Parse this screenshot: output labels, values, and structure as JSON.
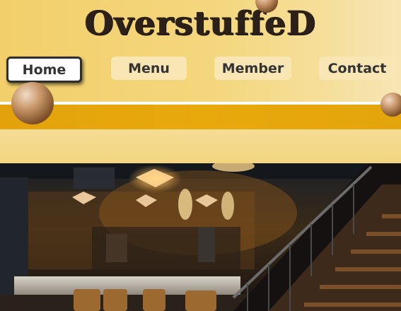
{
  "brand": {
    "title": "OverstuffeD"
  },
  "nav": [
    {
      "label": "Home",
      "active": true
    },
    {
      "label": "Menu",
      "active": false
    },
    {
      "label": "Member",
      "active": false
    },
    {
      "label": "Contact",
      "active": false
    }
  ],
  "colors": {
    "header_yellow": "#f2cf6a",
    "amber_band": "#e3a20b",
    "button_bg": "#f8e6b5",
    "text_dark": "#2c2118"
  },
  "hero": {
    "image": "restaurant-interior-photo"
  }
}
